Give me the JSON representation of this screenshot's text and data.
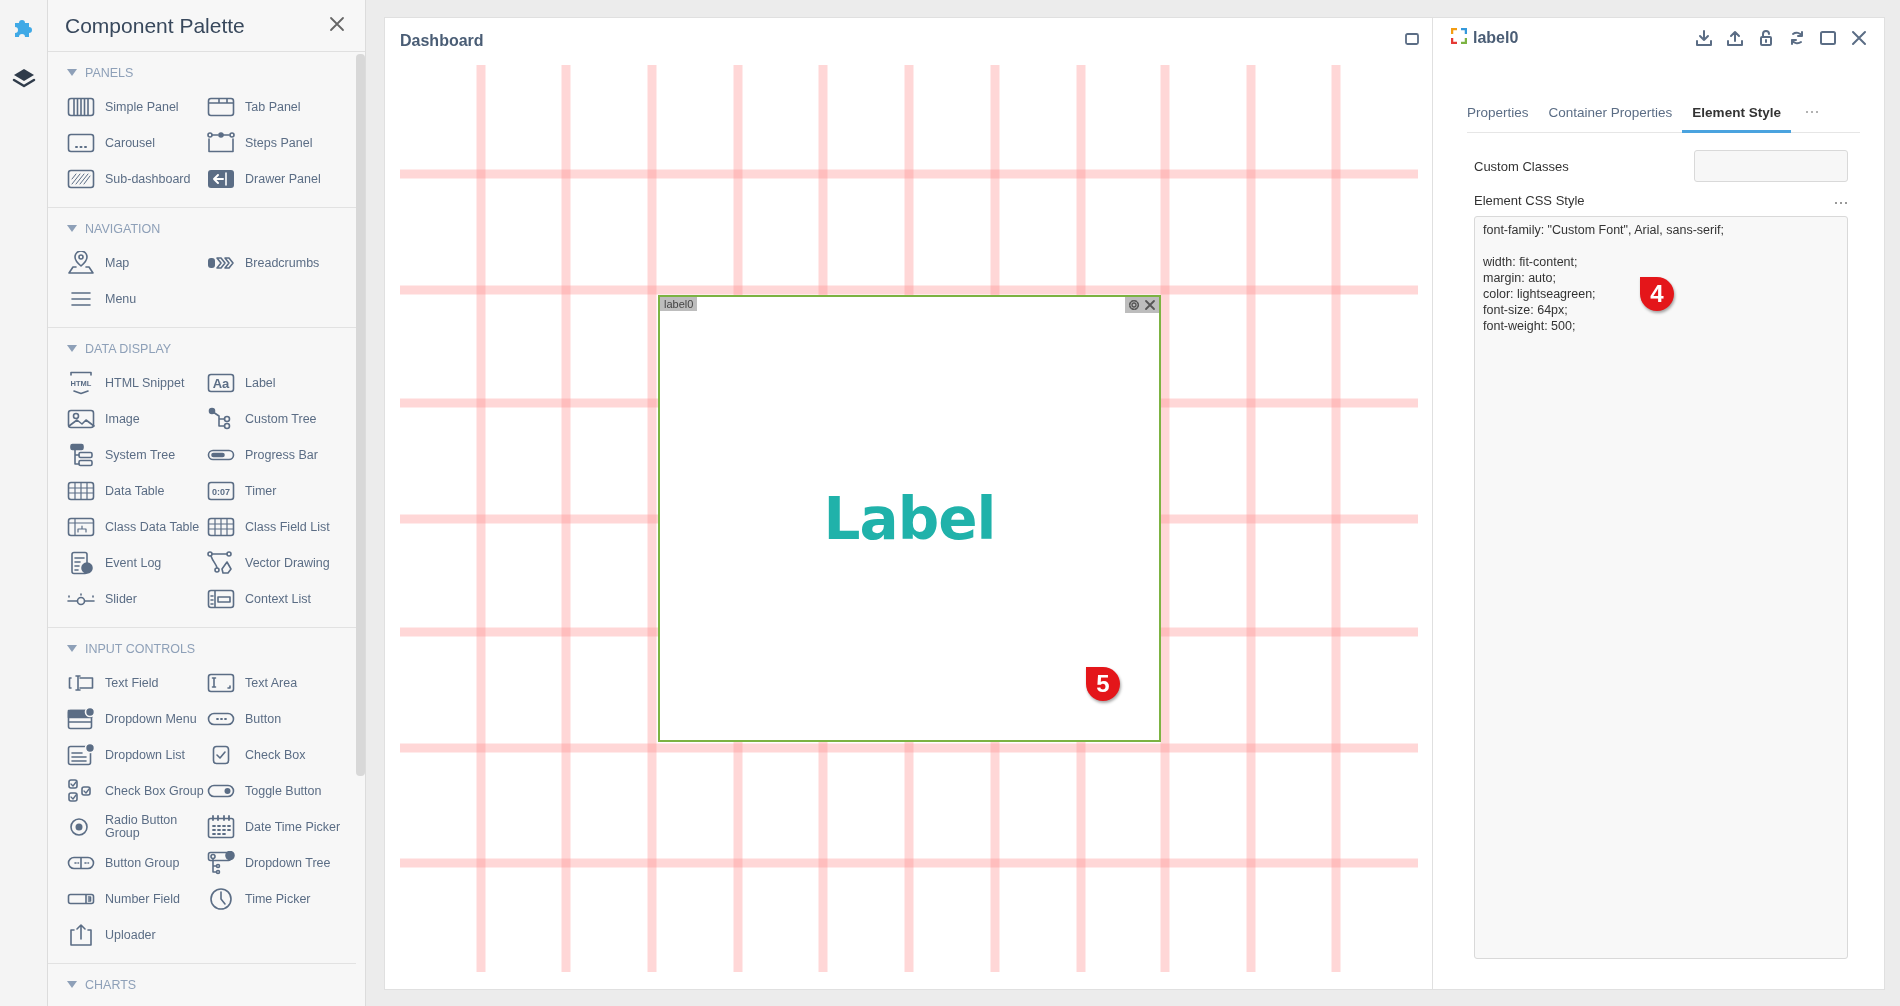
{
  "rail": {
    "items": [
      {
        "kind": "puzzle",
        "selected": true
      },
      {
        "kind": "layers",
        "selected": false
      }
    ]
  },
  "palette": {
    "title": "Component Palette",
    "sections": [
      {
        "title": "PANELS",
        "expanded": true,
        "items": [
          {
            "label": "Simple Panel",
            "kind": "striped"
          },
          {
            "label": "Tab Panel",
            "kind": "tabs"
          },
          {
            "label": "Carousel",
            "kind": "dots"
          },
          {
            "label": "Steps Panel",
            "kind": "steps"
          },
          {
            "label": "Sub-dashboard",
            "kind": "hatched"
          },
          {
            "label": "Drawer Panel",
            "kind": "drawer"
          }
        ]
      },
      {
        "title": "NAVIGATION",
        "expanded": true,
        "items": [
          {
            "label": "Map",
            "kind": "pin"
          },
          {
            "label": "Breadcrumbs",
            "kind": "chevrons"
          },
          {
            "label": "Menu",
            "kind": "lines"
          }
        ]
      },
      {
        "title": "DATA DISPLAY",
        "expanded": true,
        "items": [
          {
            "label": "HTML Snippet",
            "kind": "html",
            "glyph": "HTML"
          },
          {
            "label": "Label",
            "kind": "aa",
            "glyph": "Aa"
          },
          {
            "label": "Image",
            "kind": "picture"
          },
          {
            "label": "Custom Tree",
            "kind": "tree"
          },
          {
            "label": "System Tree",
            "kind": "systree"
          },
          {
            "label": "Progress Bar",
            "kind": "progress"
          },
          {
            "label": "Data Table",
            "kind": "table"
          },
          {
            "label": "Timer",
            "kind": "timer",
            "glyph": "0:07"
          },
          {
            "label": "Class Data Table",
            "kind": "classtable"
          },
          {
            "label": "Class Field List",
            "kind": "table"
          },
          {
            "label": "Event Log",
            "kind": "log"
          },
          {
            "label": "Vector Drawing",
            "kind": "vector"
          },
          {
            "label": "Slider",
            "kind": "slider"
          },
          {
            "label": "Context List",
            "kind": "list"
          }
        ]
      },
      {
        "title": "INPUT CONTROLS",
        "expanded": true,
        "items": [
          {
            "label": "Text Field",
            "kind": "textfield"
          },
          {
            "label": "Text Area",
            "kind": "textarea"
          },
          {
            "label": "Dropdown Menu",
            "kind": "dropdown"
          },
          {
            "label": "Button",
            "kind": "button"
          },
          {
            "label": "Dropdown List",
            "kind": "dropdownlist"
          },
          {
            "label": "Check Box",
            "kind": "checkbox"
          },
          {
            "label": "Check Box Group",
            "kind": "checkgroup"
          },
          {
            "label": "Toggle Button",
            "kind": "toggle"
          },
          {
            "label": "Radio Button Group",
            "kind": "radio"
          },
          {
            "label": "Date Time Picker",
            "kind": "calendar"
          },
          {
            "label": "Button Group",
            "kind": "buttongroup"
          },
          {
            "label": "Dropdown Tree",
            "kind": "dropdowntree"
          },
          {
            "label": "Number Field",
            "kind": "number"
          },
          {
            "label": "Time Picker",
            "kind": "clock"
          },
          {
            "label": "Uploader",
            "kind": "upload"
          }
        ]
      },
      {
        "title": "CHARTS",
        "expanded": true
      }
    ]
  },
  "dashboard": {
    "title": "Dashboard",
    "widget": {
      "tag": "label0",
      "text": "Label",
      "selected": true,
      "callout": "5"
    }
  },
  "inspector": {
    "title": "label0",
    "tabs": [
      {
        "label": "Properties",
        "selected": false
      },
      {
        "label": "Container Properties",
        "selected": false
      },
      {
        "label": "Element Style",
        "selected": true
      }
    ],
    "custom_classes": {
      "label": "Custom Classes"
    },
    "css_style": {
      "label": "Element CSS Style",
      "value": "font-family: \"Custom Font\", Arial, sans-serif;\n\nwidth: fit-content;\nmargin: auto;\ncolor: lightseagreen;\nfont-size: 64px;\nfont-weight: 500;",
      "callout": "4"
    }
  }
}
